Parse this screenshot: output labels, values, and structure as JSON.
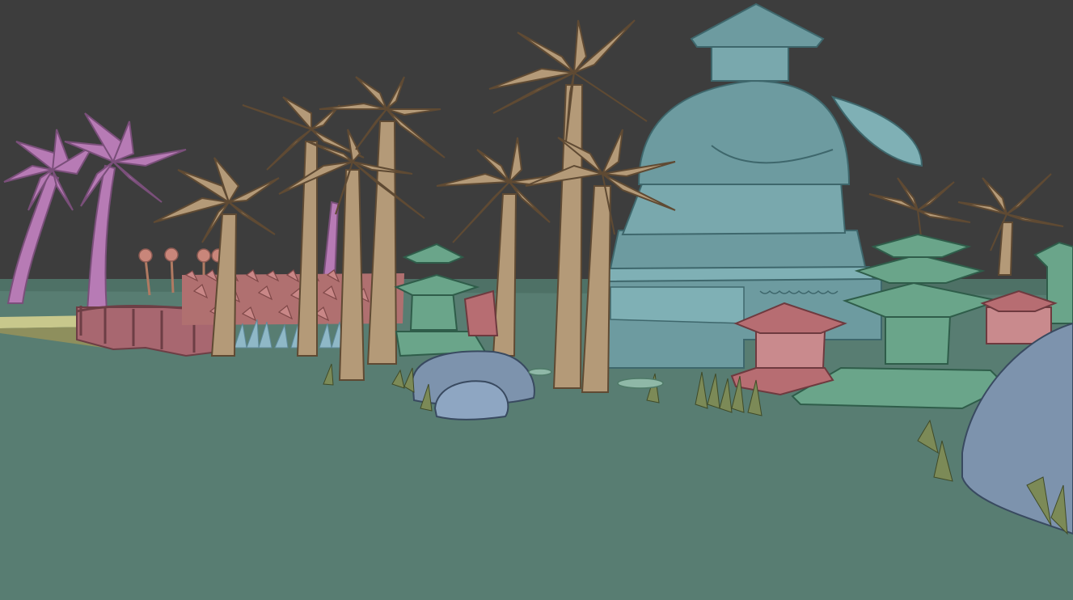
{
  "viewport": {
    "label": "",
    "background_color": "#3d3d3d",
    "ground_color": "#587d72"
  },
  "palette": {
    "palm_tan": "#b49a78",
    "palm_tan_dark": "#7c6447",
    "palm_pink": "#b77bb5",
    "palm_pink_dark": "#7a4f7a",
    "temple_teal": "#6d9ba0",
    "temple_teal_dark": "#49787e",
    "pagoda_green": "#6aa58a",
    "pagoda_green_dark": "#3f7a62",
    "hut_red": "#b76d72",
    "hut_red_dark": "#844b50",
    "rock_blue": "#7d93ad",
    "rock_blue_dark": "#53667f",
    "fence_red": "#a86770",
    "grass_olive": "#7c8a57",
    "path_yellow": "#c8c88c",
    "shrub_blue": "#8fb8c7"
  },
  "scene_objects": [
    {
      "name": "temple-tower",
      "icon": "temple-icon"
    },
    {
      "name": "palm-grove-tan",
      "icon": "palm-tree-icon"
    },
    {
      "name": "palm-grove-pink",
      "icon": "palm-tree-icon"
    },
    {
      "name": "pagoda-lantern",
      "icon": "pagoda-icon"
    },
    {
      "name": "red-hut",
      "icon": "hut-icon"
    },
    {
      "name": "boulder",
      "icon": "rock-icon"
    },
    {
      "name": "wooden-bridge",
      "icon": "bridge-icon"
    },
    {
      "name": "thatch-fence",
      "icon": "fence-icon"
    },
    {
      "name": "grass-tufts",
      "icon": "grass-icon"
    }
  ]
}
